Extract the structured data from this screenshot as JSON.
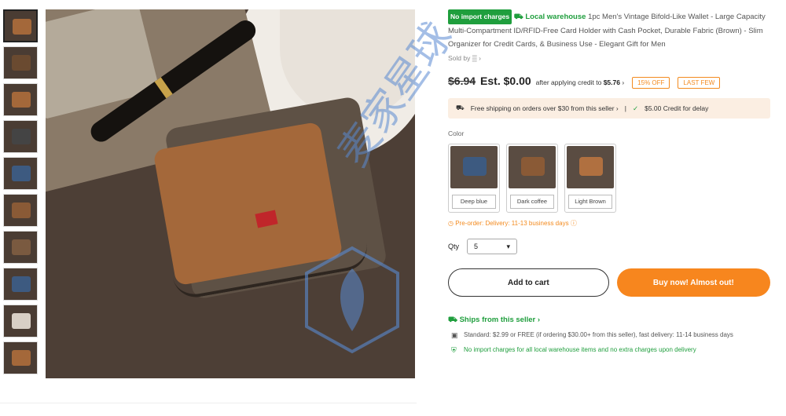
{
  "thumbnails": [
    {
      "color": "#a4683a"
    },
    {
      "color": "#6a4a30"
    },
    {
      "color": "#a4683a"
    },
    {
      "color": "#444444"
    },
    {
      "color": "#3d5a80"
    },
    {
      "color": "#8a5a36"
    },
    {
      "color": "#7a5a40"
    },
    {
      "color": "#3d5a80"
    },
    {
      "color": "#d8cfc5"
    },
    {
      "color": "#a4683a"
    }
  ],
  "product": {
    "import_badge": "No import charges",
    "local_badge": "Local warehouse",
    "title": "1pc Men's Vintage Bifold-Like Wallet - Large Capacity Multi-Compartment ID/RFID-Free Card Holder with Cash Pocket, Durable Fabric (Brown) - Slim Organizer for Credit Cards, & Business Use - Elegant Gift for Men",
    "sold_by": "Sold by"
  },
  "price": {
    "old": "$6.94",
    "est_label": "Est.",
    "est": "$0.00",
    "credit_text": "after applying credit to",
    "credit_amount": "$5.76",
    "discount_chip": "15% OFF",
    "stock_chip": "LAST FEW"
  },
  "shipping_bar": {
    "free_text": "Free shipping on orders over $30 from this seller",
    "credit_text": "$5.00 Credit for delay"
  },
  "color": {
    "label": "Color",
    "options": [
      {
        "label": "Deep blue",
        "tone": "#3d5a80"
      },
      {
        "label": "Dark coffee",
        "tone": "#8a5a36"
      },
      {
        "label": "Light Brown",
        "tone": "#b07040"
      }
    ]
  },
  "preorder": "Pre-order: Delivery: 11-13 business days",
  "qty": {
    "label": "Qty",
    "value": "5"
  },
  "buttons": {
    "cart": "Add to cart",
    "buy": "Buy now! Almost out!"
  },
  "ships": {
    "title": "Ships from this seller",
    "standard": "Standard: $2.99 or FREE (if ordering $30.00+ from this seller), fast delivery: 11-14 business days",
    "no_import": "No import charges for all local warehouse items and no extra charges upon delivery"
  },
  "watermark": "麦家星球"
}
